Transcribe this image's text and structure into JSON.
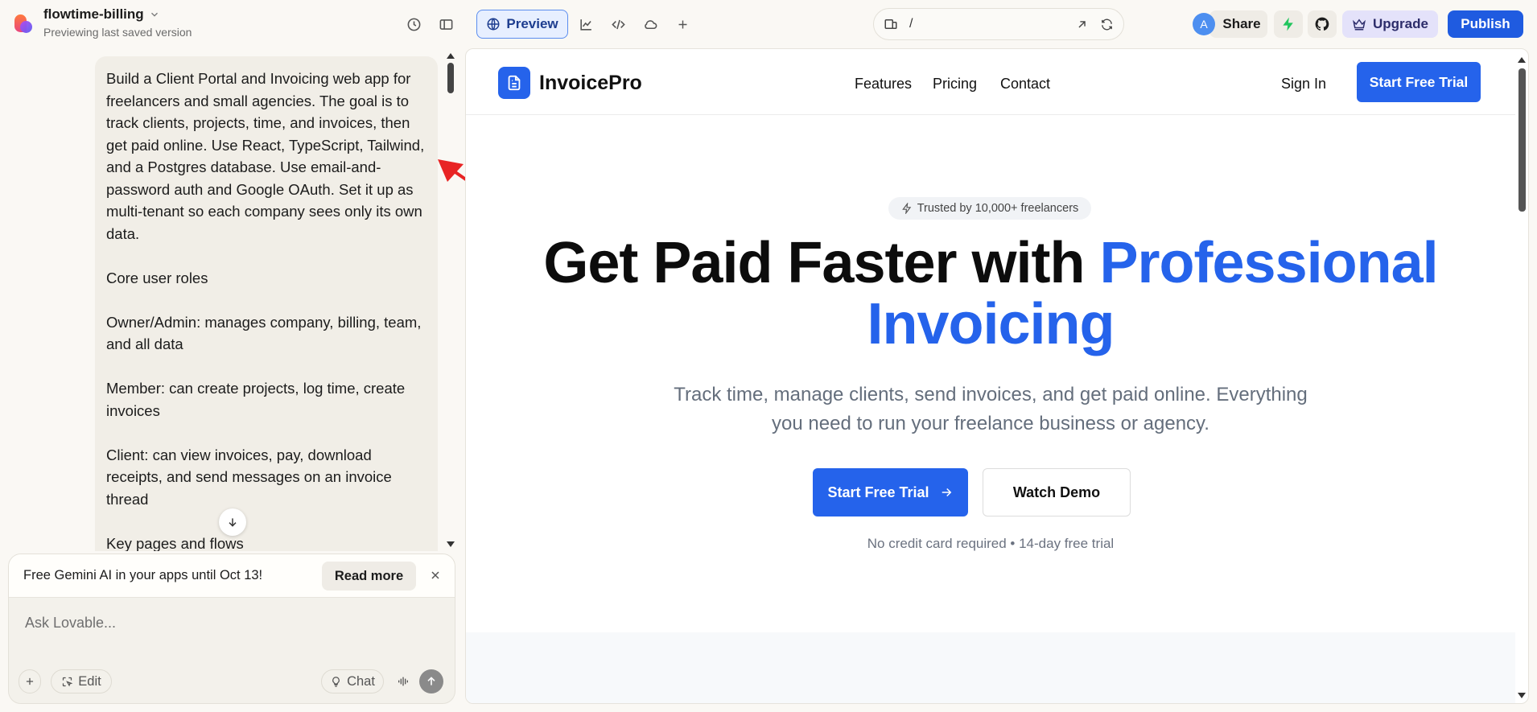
{
  "project": {
    "name": "flowtime-billing",
    "subtitle": "Previewing last saved version"
  },
  "toolbar": {
    "preview_label": "Preview",
    "url_path": "/",
    "avatar_initial": "A",
    "share_label": "Share",
    "upgrade_label": "Upgrade",
    "publish_label": "Publish"
  },
  "chat": {
    "message": {
      "paragraphs": [
        "Build a Client Portal and Invoicing web app for freelancers and small agencies. The goal is to track clients, projects, time, and invoices, then get paid online. Use React, TypeScript, Tailwind, and a Postgres database. Use email-and-password auth and Google OAuth. Set it up as multi-tenant so each company sees only its own data.",
        "Core user roles",
        "Owner/Admin: manages company, billing, team, and all data",
        "Member: can create projects, log time, create invoices",
        "Client: can view invoices, pay, download receipts, and send messages on an invoice thread",
        "Key pages and flows"
      ]
    },
    "promo": {
      "text": "Free Gemini AI in your apps until Oct 13!",
      "read_more": "Read more"
    },
    "composer": {
      "placeholder": "Ask Lovable...",
      "edit_label": "Edit",
      "chat_label": "Chat"
    }
  },
  "site": {
    "brand": "InvoicePro",
    "nav": [
      "Features",
      "Pricing",
      "Contact"
    ],
    "sign_in": "Sign In",
    "nav_cta": "Start Free Trial",
    "badge": "Trusted by 10,000+ freelancers",
    "hero_part1": "Get Paid Faster with ",
    "hero_part2": "Professional Invoicing",
    "hero_sub": "Track time, manage clients, send invoices, and get paid online. Everything you need to run your freelance business or agency.",
    "cta_primary": "Start Free Trial",
    "cta_secondary": "Watch Demo",
    "fineprint": "No credit card required • 14-day free trial"
  },
  "colors": {
    "accent": "#2563eb",
    "publish": "#1f5be0",
    "annotation": "#e82424"
  }
}
